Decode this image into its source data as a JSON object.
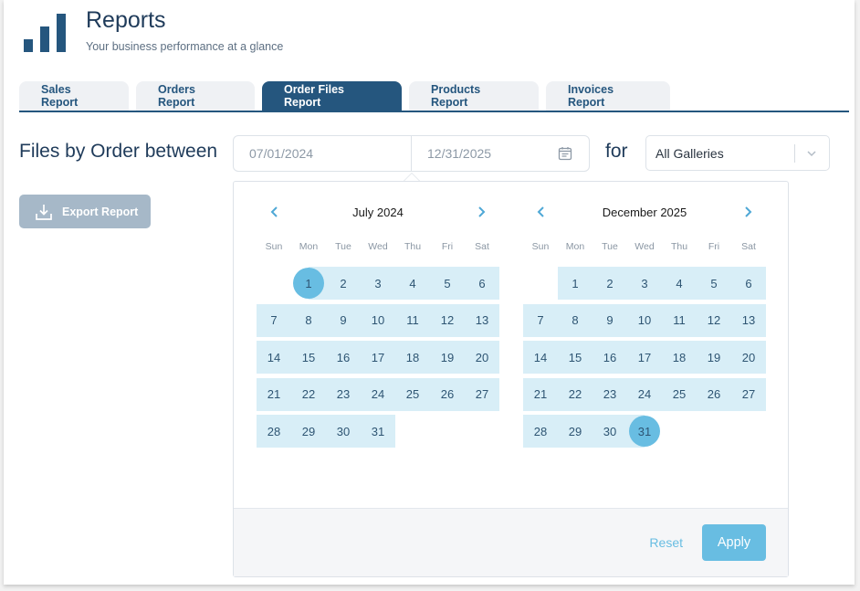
{
  "header": {
    "icon": "bar-chart-icon",
    "title": "Reports",
    "subtitle": "Your business performance at a glance"
  },
  "tabs": [
    {
      "label": "Sales Report",
      "active": false
    },
    {
      "label": "Orders Report",
      "active": false
    },
    {
      "label": "Order Files Report",
      "active": true
    },
    {
      "label": "Products Report",
      "active": false
    },
    {
      "label": "Invoices Report",
      "active": false
    }
  ],
  "filter": {
    "label": "Files by Order between",
    "start_date": "07/01/2024",
    "end_date": "12/31/2025",
    "calendar_icon": "calendar-icon",
    "for_label": "for",
    "gallery_select": {
      "value": "All Galleries",
      "icon": "chevron-down-icon"
    }
  },
  "export": {
    "label": "Export Report",
    "icon": "download-icon"
  },
  "picker": {
    "weekdays": [
      "Sun",
      "Mon",
      "Tue",
      "Wed",
      "Thu",
      "Fri",
      "Sat"
    ],
    "months": [
      {
        "title": "July 2024",
        "weeks": [
          [
            "",
            "1",
            "2",
            "3",
            "4",
            "5",
            "6"
          ],
          [
            "7",
            "8",
            "9",
            "10",
            "11",
            "12",
            "13"
          ],
          [
            "14",
            "15",
            "16",
            "17",
            "18",
            "19",
            "20"
          ],
          [
            "21",
            "22",
            "23",
            "24",
            "25",
            "26",
            "27"
          ],
          [
            "28",
            "29",
            "30",
            "31",
            "",
            "",
            ""
          ]
        ],
        "selected_start": "1"
      },
      {
        "title": "December 2025",
        "weeks": [
          [
            "",
            "1",
            "2",
            "3",
            "4",
            "5",
            "6"
          ],
          [
            "7",
            "8",
            "9",
            "10",
            "11",
            "12",
            "13"
          ],
          [
            "14",
            "15",
            "16",
            "17",
            "18",
            "19",
            "20"
          ],
          [
            "21",
            "22",
            "23",
            "24",
            "25",
            "26",
            "27"
          ],
          [
            "28",
            "29",
            "30",
            "31",
            "",
            "",
            ""
          ]
        ],
        "selected_end": "31"
      }
    ],
    "prev_icon": "chevron-left-icon",
    "next_icon": "chevron-right-icon",
    "reset_label": "Reset",
    "apply_label": "Apply",
    "colors": {
      "range": "#d8eef7",
      "selected": "#68bde2",
      "primary": "#25567e"
    }
  }
}
